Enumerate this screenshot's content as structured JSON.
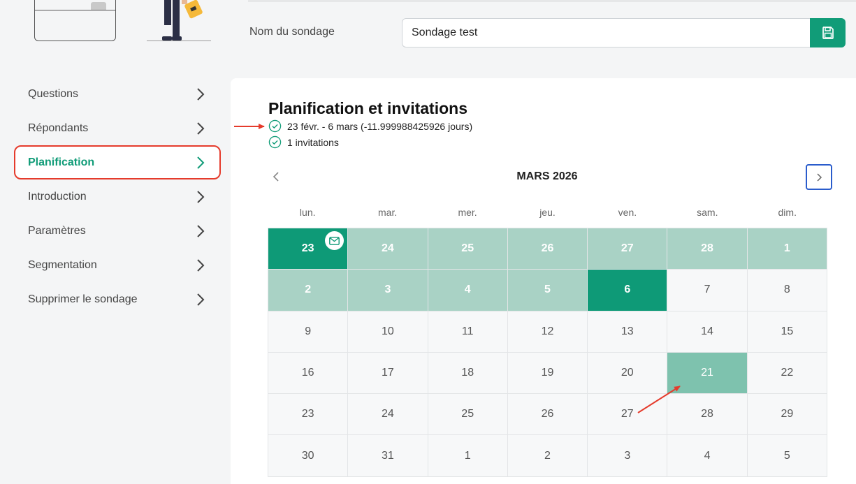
{
  "header": {
    "name_label": "Nom du sondage",
    "name_value": "Sondage test",
    "save_icon": "floppy-disk-icon"
  },
  "sidebar": {
    "items": [
      {
        "label": "Questions"
      },
      {
        "label": "Répondants"
      },
      {
        "label": "Planification",
        "active": true
      },
      {
        "label": "Introduction"
      },
      {
        "label": "Paramètres"
      },
      {
        "label": "Segmentation"
      },
      {
        "label": "Supprimer le sondage"
      }
    ]
  },
  "main": {
    "title": "Planification et invitations",
    "period": "23 févr. - 6 mars (-11.999988425926 jours)",
    "invitations": "1 invitations"
  },
  "calendar": {
    "month": "MARS 2026",
    "weekdays": [
      "lun.",
      "mar.",
      "mer.",
      "jeu.",
      "ven.",
      "sam.",
      "dim."
    ],
    "days": [
      {
        "d": "23",
        "s": "edge",
        "mail": true
      },
      {
        "d": "24",
        "s": "range"
      },
      {
        "d": "25",
        "s": "range"
      },
      {
        "d": "26",
        "s": "range"
      },
      {
        "d": "27",
        "s": "range"
      },
      {
        "d": "28",
        "s": "range"
      },
      {
        "d": "1",
        "s": "range"
      },
      {
        "d": "2",
        "s": "range"
      },
      {
        "d": "3",
        "s": "range"
      },
      {
        "d": "4",
        "s": "range"
      },
      {
        "d": "5",
        "s": "range"
      },
      {
        "d": "6",
        "s": "edge"
      },
      {
        "d": "7",
        "s": ""
      },
      {
        "d": "8",
        "s": ""
      },
      {
        "d": "9",
        "s": ""
      },
      {
        "d": "10",
        "s": ""
      },
      {
        "d": "11",
        "s": ""
      },
      {
        "d": "12",
        "s": ""
      },
      {
        "d": "13",
        "s": ""
      },
      {
        "d": "14",
        "s": ""
      },
      {
        "d": "15",
        "s": ""
      },
      {
        "d": "16",
        "s": ""
      },
      {
        "d": "17",
        "s": ""
      },
      {
        "d": "18",
        "s": ""
      },
      {
        "d": "19",
        "s": ""
      },
      {
        "d": "20",
        "s": ""
      },
      {
        "d": "21",
        "s": "hl"
      },
      {
        "d": "22",
        "s": ""
      },
      {
        "d": "23",
        "s": ""
      },
      {
        "d": "24",
        "s": ""
      },
      {
        "d": "25",
        "s": ""
      },
      {
        "d": "26",
        "s": ""
      },
      {
        "d": "27",
        "s": ""
      },
      {
        "d": "28",
        "s": ""
      },
      {
        "d": "29",
        "s": ""
      },
      {
        "d": "30",
        "s": ""
      },
      {
        "d": "31",
        "s": ""
      },
      {
        "d": "1",
        "s": ""
      },
      {
        "d": "2",
        "s": ""
      },
      {
        "d": "3",
        "s": ""
      },
      {
        "d": "4",
        "s": ""
      },
      {
        "d": "5",
        "s": ""
      }
    ]
  },
  "colors": {
    "accent": "#119c78",
    "range": "#a9d2c5",
    "highlight": "#7ec2ae",
    "annotation": "#e53b2c",
    "next_button_border": "#2a5ccc"
  }
}
